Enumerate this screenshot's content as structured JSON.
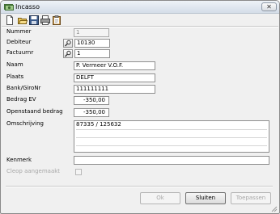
{
  "window": {
    "title": "Incasso",
    "title_icon": "money-icon",
    "close_glyph": "✕"
  },
  "toolbar": {
    "icons": [
      "new-document-icon",
      "open-folder-icon",
      "save-icon",
      "print-icon",
      "clipboard-icon"
    ]
  },
  "form": {
    "nummer": {
      "label": "Nummer",
      "value": "1"
    },
    "debiteur": {
      "label": "Debiteur",
      "value": "10130",
      "picker_icon": "lookup-icon"
    },
    "factuurnr": {
      "label": "Factuurnr",
      "value": "1",
      "picker_icon": "lookup-icon"
    },
    "naam": {
      "label": "Naam",
      "value": "P. Vermeer V.O.F."
    },
    "plaats": {
      "label": "Plaats",
      "value": "DELFT"
    },
    "bank": {
      "label": "Bank/GiroNr",
      "value": "111111111"
    },
    "bedrag_ev": {
      "label": "Bedrag EV",
      "value": "-350,00"
    },
    "openstaand": {
      "label": "Openstaand bedrag",
      "value": "-350,00"
    },
    "omschrijving": {
      "label": "Omschrijving",
      "lines": [
        "87335 / 125632",
        "",
        "",
        ""
      ]
    },
    "kenmerk": {
      "label": "Kenmerk",
      "value": ""
    },
    "cleop": {
      "label": "Cleop aangemaakt",
      "checked": false
    }
  },
  "buttons": {
    "ok": "Ok",
    "sluiten": "Sluiten",
    "toepassen": "Toepassen"
  },
  "colors": {
    "title_gradient_top": "#eef3f8",
    "title_gradient_bottom": "#d4dde8",
    "dialog_bg": "#f0f0f0",
    "disabled_text": "#a8a8a8"
  }
}
